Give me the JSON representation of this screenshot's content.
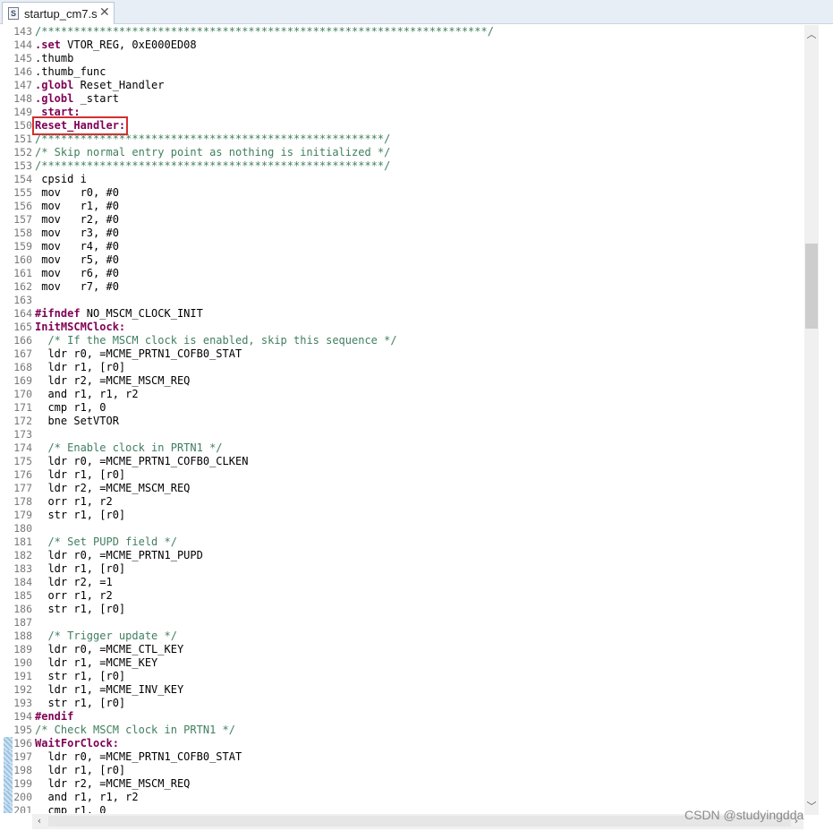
{
  "tab": {
    "icon": "asm-file-icon",
    "title": "startup_cm7.s",
    "close": "✕"
  },
  "watermark": "CSDN @studyingdda",
  "lines": [
    {
      "n": "143",
      "parts": [
        [
          "com",
          "/*********************************************************************/"
        ]
      ]
    },
    {
      "n": "144",
      "parts": [
        [
          "dir",
          ".set"
        ],
        [
          "pl",
          " VTOR_REG, 0xE000ED08"
        ]
      ]
    },
    {
      "n": "145",
      "parts": [
        [
          "pl",
          ".thumb"
        ]
      ]
    },
    {
      "n": "146",
      "parts": [
        [
          "pl",
          ".thumb_func"
        ]
      ]
    },
    {
      "n": "147",
      "parts": [
        [
          "dir",
          ".globl"
        ],
        [
          "pl",
          " Reset_Handler"
        ]
      ]
    },
    {
      "n": "148",
      "parts": [
        [
          "dir",
          ".globl"
        ],
        [
          "pl",
          " _start"
        ]
      ]
    },
    {
      "n": "149",
      "parts": [
        [
          "lbl",
          "_start:"
        ]
      ]
    },
    {
      "n": "150",
      "parts": [
        [
          "lbl",
          "Reset_Handler:"
        ]
      ],
      "boxed": true
    },
    {
      "n": "151",
      "parts": [
        [
          "com",
          "/*****************************************************/"
        ]
      ]
    },
    {
      "n": "152",
      "parts": [
        [
          "com",
          "/* Skip normal entry point as nothing is initialized */"
        ]
      ]
    },
    {
      "n": "153",
      "parts": [
        [
          "com",
          "/*****************************************************/"
        ]
      ]
    },
    {
      "n": "154",
      "parts": [
        [
          "pl",
          " cpsid i"
        ]
      ]
    },
    {
      "n": "155",
      "parts": [
        [
          "pl",
          " mov   r0, #0"
        ]
      ]
    },
    {
      "n": "156",
      "parts": [
        [
          "pl",
          " mov   r1, #0"
        ]
      ]
    },
    {
      "n": "157",
      "parts": [
        [
          "pl",
          " mov   r2, #0"
        ]
      ]
    },
    {
      "n": "158",
      "parts": [
        [
          "pl",
          " mov   r3, #0"
        ]
      ]
    },
    {
      "n": "159",
      "parts": [
        [
          "pl",
          " mov   r4, #0"
        ]
      ]
    },
    {
      "n": "160",
      "parts": [
        [
          "pl",
          " mov   r5, #0"
        ]
      ]
    },
    {
      "n": "161",
      "parts": [
        [
          "pl",
          " mov   r6, #0"
        ]
      ]
    },
    {
      "n": "162",
      "parts": [
        [
          "pl",
          " mov   r7, #0"
        ]
      ]
    },
    {
      "n": "163",
      "parts": []
    },
    {
      "n": "164",
      "parts": [
        [
          "dir",
          "#ifndef"
        ],
        [
          "pl",
          " NO_MSCM_CLOCK_INIT"
        ]
      ]
    },
    {
      "n": "165",
      "parts": [
        [
          "lbl",
          "InitMSCMClock:"
        ]
      ]
    },
    {
      "n": "166",
      "parts": [
        [
          "pl",
          "  "
        ],
        [
          "com",
          "/* If the MSCM clock is enabled, skip this sequence */"
        ]
      ]
    },
    {
      "n": "167",
      "parts": [
        [
          "pl",
          "  ldr r0, =MCME_PRTN1_COFB0_STAT"
        ]
      ]
    },
    {
      "n": "168",
      "parts": [
        [
          "pl",
          "  ldr r1, [r0]"
        ]
      ]
    },
    {
      "n": "169",
      "parts": [
        [
          "pl",
          "  ldr r2, =MCME_MSCM_REQ"
        ]
      ]
    },
    {
      "n": "170",
      "parts": [
        [
          "pl",
          "  and r1, r1, r2"
        ]
      ]
    },
    {
      "n": "171",
      "parts": [
        [
          "pl",
          "  cmp r1, 0"
        ]
      ]
    },
    {
      "n": "172",
      "parts": [
        [
          "pl",
          "  bne SetVTOR"
        ]
      ]
    },
    {
      "n": "173",
      "parts": []
    },
    {
      "n": "174",
      "parts": [
        [
          "pl",
          "  "
        ],
        [
          "com",
          "/* Enable clock in PRTN1 */"
        ]
      ]
    },
    {
      "n": "175",
      "parts": [
        [
          "pl",
          "  ldr r0, =MCME_PRTN1_COFB0_CLKEN"
        ]
      ]
    },
    {
      "n": "176",
      "parts": [
        [
          "pl",
          "  ldr r1, [r0]"
        ]
      ]
    },
    {
      "n": "177",
      "parts": [
        [
          "pl",
          "  ldr r2, =MCME_MSCM_REQ"
        ]
      ]
    },
    {
      "n": "178",
      "parts": [
        [
          "pl",
          "  orr r1, r2"
        ]
      ]
    },
    {
      "n": "179",
      "parts": [
        [
          "pl",
          "  str r1, [r0]"
        ]
      ]
    },
    {
      "n": "180",
      "parts": []
    },
    {
      "n": "181",
      "parts": [
        [
          "pl",
          "  "
        ],
        [
          "com",
          "/* Set PUPD field */"
        ]
      ]
    },
    {
      "n": "182",
      "parts": [
        [
          "pl",
          "  ldr r0, =MCME_PRTN1_PUPD"
        ]
      ]
    },
    {
      "n": "183",
      "parts": [
        [
          "pl",
          "  ldr r1, [r0]"
        ]
      ]
    },
    {
      "n": "184",
      "parts": [
        [
          "pl",
          "  ldr r2, =1"
        ]
      ]
    },
    {
      "n": "185",
      "parts": [
        [
          "pl",
          "  orr r1, r2"
        ]
      ]
    },
    {
      "n": "186",
      "parts": [
        [
          "pl",
          "  str r1, [r0]"
        ]
      ]
    },
    {
      "n": "187",
      "parts": []
    },
    {
      "n": "188",
      "parts": [
        [
          "pl",
          "  "
        ],
        [
          "com",
          "/* Trigger update */"
        ]
      ]
    },
    {
      "n": "189",
      "parts": [
        [
          "pl",
          "  ldr r0, =MCME_CTL_KEY"
        ]
      ]
    },
    {
      "n": "190",
      "parts": [
        [
          "pl",
          "  ldr r1, =MCME_KEY"
        ]
      ]
    },
    {
      "n": "191",
      "parts": [
        [
          "pl",
          "  str r1, [r0]"
        ]
      ]
    },
    {
      "n": "192",
      "parts": [
        [
          "pl",
          "  ldr r1, =MCME_INV_KEY"
        ]
      ]
    },
    {
      "n": "193",
      "parts": [
        [
          "pl",
          "  str r1, [r0]"
        ]
      ]
    },
    {
      "n": "194",
      "parts": [
        [
          "dir",
          "#endif"
        ]
      ]
    },
    {
      "n": "195",
      "parts": [
        [
          "com",
          "/* Check MSCM clock in PRTN1 */"
        ]
      ]
    },
    {
      "n": "196",
      "parts": [
        [
          "lbl",
          "WaitForClock:"
        ]
      ],
      "mark": true
    },
    {
      "n": "197",
      "parts": [
        [
          "pl",
          "  ldr r0, =MCME_PRTN1_COFB0_STAT"
        ]
      ],
      "mark": true
    },
    {
      "n": "198",
      "parts": [
        [
          "pl",
          "  ldr r1, [r0]"
        ]
      ],
      "mark": true
    },
    {
      "n": "199",
      "parts": [
        [
          "pl",
          "  ldr r2, =MCME_MSCM_REQ"
        ]
      ],
      "mark": true
    },
    {
      "n": "200",
      "parts": [
        [
          "pl",
          "  and r1, r1, r2"
        ]
      ],
      "mark": true
    },
    {
      "n": "201",
      "parts": [
        [
          "pl",
          "  cmp r1, 0"
        ]
      ],
      "mark": true
    }
  ]
}
